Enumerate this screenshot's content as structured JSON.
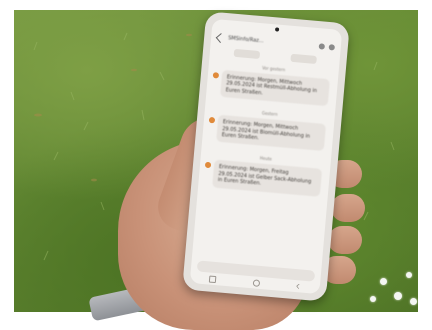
{
  "phone": {
    "contact_name": "SMSinfo/Raz...",
    "messages": [
      {
        "date": "Vor gestern",
        "text": "Erinnerung: Morgen, Mittwoch 29.05.2024 ist Restmüll-Abholung in Euren Straßen.",
        "time": ""
      },
      {
        "date": "Gestern",
        "text": "Erinnerung: Morgen, Mittwoch 29.05.2024 ist Biomüll-Abholung in Euren Straßen.",
        "time": ""
      },
      {
        "date": "Heute",
        "text": "Erinnerung: Morgen, Freitag 29.05.2024 ist Gelber Sack-Abholung in Euren Straßen.",
        "time": ""
      }
    ]
  },
  "colors": {
    "grass": "#5e8430",
    "skin": "#c99278",
    "phone_frame": "#e4e1dd",
    "screen_bg": "#f3f1ee",
    "bubble": "#e7e3df",
    "avatar": "#e08a3a"
  }
}
